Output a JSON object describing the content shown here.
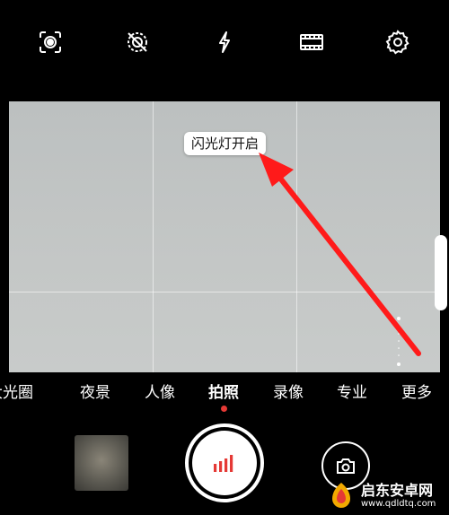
{
  "topbar": {
    "icons": [
      "ai-lens-icon",
      "moving-picture-off-icon",
      "flash-icon",
      "aspect-ratio-icon",
      "settings-icon"
    ]
  },
  "viewfinder": {
    "toast": "闪光灯开启"
  },
  "modes": {
    "items": [
      "大光圈",
      "夜景",
      "人像",
      "拍照",
      "录像",
      "专业",
      "更多"
    ],
    "active": "拍照"
  },
  "watermark": {
    "title": "启东安卓网",
    "url": "www.qdldtq.com"
  },
  "colors": {
    "accent": "#e53935",
    "annotation_arrow": "#ff1a1a"
  }
}
